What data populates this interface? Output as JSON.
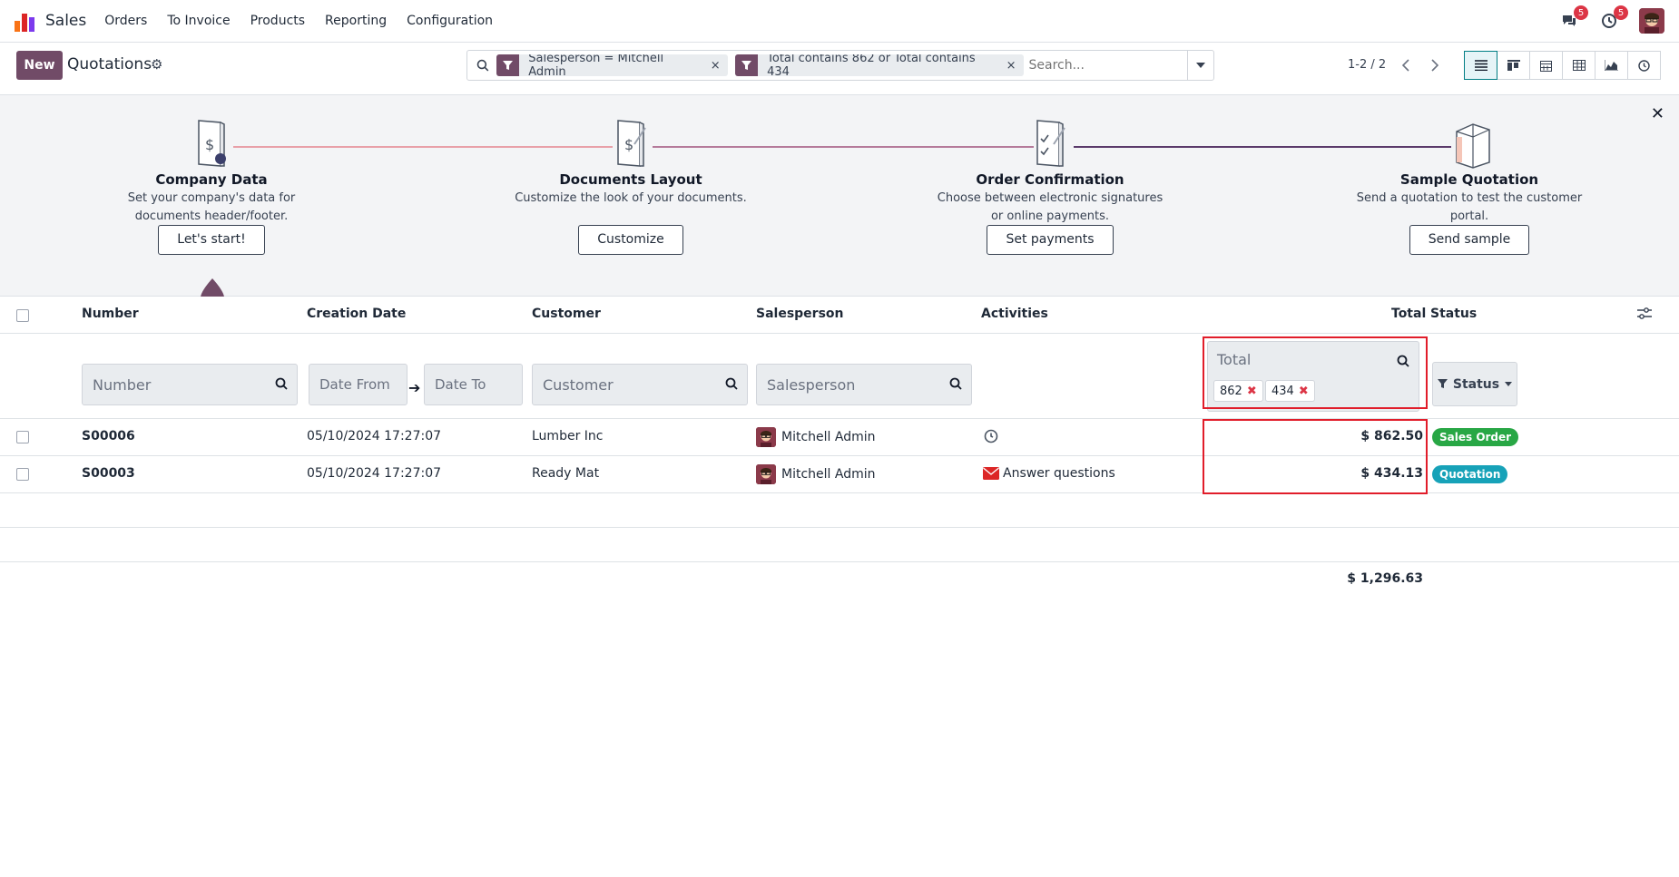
{
  "nav": {
    "app_name": "Sales",
    "menu": [
      "Orders",
      "To Invoice",
      "Products",
      "Reporting",
      "Configuration"
    ],
    "messages_count": "5",
    "activities_count": "5"
  },
  "control": {
    "new_label": "New",
    "breadcrumb": "Quotations",
    "facets": [
      {
        "label": "Salesperson = Mitchell Admin"
      },
      {
        "label": "Total contains 862 or Total contains 434"
      }
    ],
    "search_placeholder": "Search...",
    "pager": "1-2 / 2"
  },
  "onboarding": {
    "steps": [
      {
        "title": "Company Data",
        "desc": "Set your company's data for documents header/footer.",
        "button": "Let's start!"
      },
      {
        "title": "Documents Layout",
        "desc": "Customize the look of your documents.",
        "button": "Customize"
      },
      {
        "title": "Order Confirmation",
        "desc": "Choose between electronic signatures or online payments.",
        "button": "Set payments"
      },
      {
        "title": "Sample Quotation",
        "desc": "Send a quotation to test the customer portal.",
        "button": "Send sample"
      }
    ]
  },
  "columns": {
    "number": "Number",
    "creation_date": "Creation Date",
    "customer": "Customer",
    "salesperson": "Salesperson",
    "activities": "Activities",
    "total": "Total",
    "status": "Status"
  },
  "filters": {
    "number_placeholder": "Number",
    "date_from": "Date From",
    "date_to": "Date To",
    "customer_placeholder": "Customer",
    "salesperson_placeholder": "Salesperson",
    "total_label": "Total",
    "total_tags": [
      "862",
      "434"
    ],
    "status_label": "Status"
  },
  "rows": [
    {
      "number": "S00006",
      "date": "05/10/2024 17:27:07",
      "customer": "Lumber Inc",
      "salesperson": "Mitchell Admin",
      "activity": "",
      "total": "$ 862.50",
      "status": "Sales Order",
      "status_color": "#28a745"
    },
    {
      "number": "S00003",
      "date": "05/10/2024 17:27:07",
      "customer": "Ready Mat",
      "salesperson": "Mitchell Admin",
      "activity": "Answer questions",
      "total": "$ 434.13",
      "status": "Quotation",
      "status_color": "#17a2b8"
    }
  ],
  "sum_total": "$ 1,296.63",
  "colors": {
    "primary": "#714b67",
    "highlight": "#e11d2a"
  }
}
